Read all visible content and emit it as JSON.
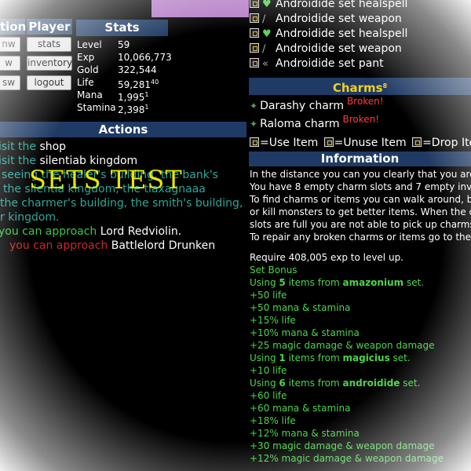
{
  "nav": {
    "player_header": "Player",
    "stats_button": "stats",
    "inventory_button": "inventory",
    "logout_button": "logout",
    "left_header_partial": "tion",
    "left_btns": [
      "nw",
      "w",
      "sw"
    ]
  },
  "stats": {
    "title": "Stats",
    "rows": [
      {
        "label": "Level",
        "value": "59",
        "sup": ""
      },
      {
        "label": "Exp",
        "value": "10,066,773",
        "sup": ""
      },
      {
        "label": "Gold",
        "value": "322,544",
        "sup": ""
      },
      {
        "label": "Life",
        "value": "59,281",
        "sup": "40"
      },
      {
        "label": "Mana",
        "value": "1,995",
        "sup": "1"
      },
      {
        "label": "Stamina",
        "value": "2,398",
        "sup": "1"
      }
    ]
  },
  "actions": {
    "title": "Actions",
    "lines": [
      {
        "prefix": "isit the ",
        "target": "shop"
      },
      {
        "prefix": "isit the ",
        "target": "silentiab kingdom"
      },
      {
        "text": "seeing the healer's building, the bank's"
      },
      {
        "text": "the silentia kingdom, the tiaxagnaaa"
      },
      {
        "text": "the charmer's building, the smith's building,"
      },
      {
        "text": "r kingdom."
      },
      {
        "prefix": "you can approach ",
        "target": "Lord Redviolin."
      },
      {
        "prefix": "you can approach ",
        "target": "Battlelord Drunken"
      }
    ],
    "overlay_label": "SETS TEST"
  },
  "items": [
    {
      "icon": "heart-icon",
      "name": "Androidide set healspell"
    },
    {
      "icon": "sword-icon",
      "name": "Androidide set weapon"
    },
    {
      "icon": "heart-icon",
      "name": "Androidide set healspell"
    },
    {
      "icon": "sword-icon",
      "name": "Androidide set weapon"
    },
    {
      "icon": "boot-icon",
      "name": "Androidide set pant"
    }
  ],
  "charms": {
    "title": "Charms",
    "count": "8",
    "list": [
      {
        "name": "Darashy charm",
        "status": "Broken!"
      },
      {
        "name": "Raloma charm",
        "status": "Broken!"
      }
    ]
  },
  "legend": {
    "use": "=Use Item",
    "unuse": "=Unuse Item",
    "drop": "=Drop Item"
  },
  "information": {
    "title": "Information",
    "intro": [
      "In the distance you can you clearly that you are",
      "You have 8 empty charm slots and 7 empty inve",
      "To find charms or items you can walk around, bu",
      "or kill monsters to get better items. When the c",
      "slots are full you are not able to pick up charms",
      "To repair any broken charms or items go to the s"
    ],
    "require": "Require 408,005 exp to level up.",
    "set_bonus_label": "Set Bonus",
    "sets": [
      {
        "count": "5",
        "name": "amazonium",
        "bonuses": [
          "+50 life",
          "+50 mana & stamina",
          "+15% life",
          "+10% mana & stamina",
          "+25 magic damage & weapon damage"
        ]
      },
      {
        "count": "1",
        "name": "magicius",
        "bonuses": [
          "+10 life"
        ]
      },
      {
        "count": "6",
        "name": "androidide",
        "bonuses": [
          "+60 life",
          "+60 mana & stamina",
          "+18% life",
          "+12% mana & stamina",
          "+30 magic damage & weapon damage",
          "+12% magic damage & weapon damage"
        ]
      }
    ],
    "using_prefix": "Using ",
    "items_from": " items from ",
    "set_suffix": " set."
  },
  "colors": {
    "header_bg": "#1f3a64",
    "accent_purple": "#b67ec7",
    "green": "#4bd44b",
    "teal": "#2aa79a",
    "red": "#c8282a",
    "overlay_yellow": "#e6e600"
  }
}
